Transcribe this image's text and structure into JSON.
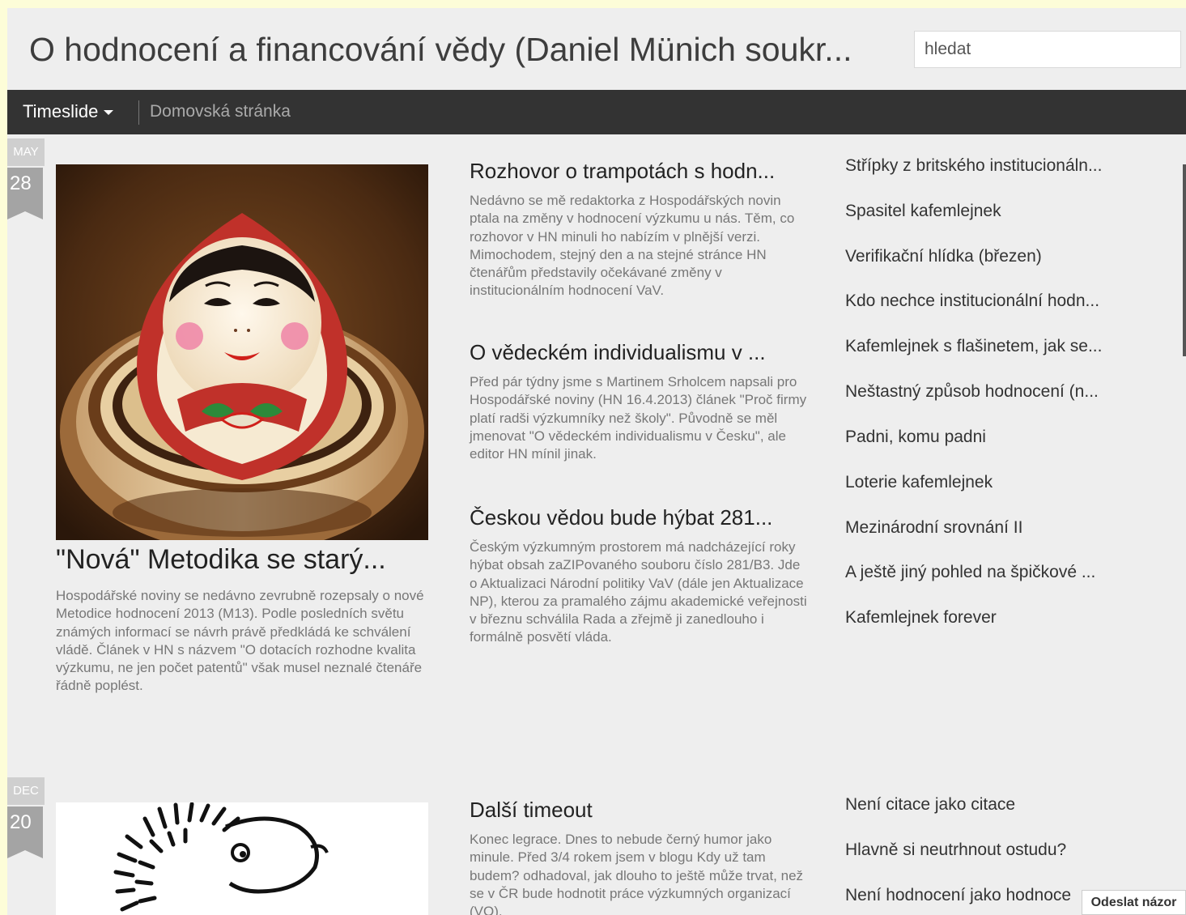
{
  "header": {
    "title": "O hodnocení a financování vědy (Daniel Münich soukr...",
    "search_placeholder": "hledat"
  },
  "nav": {
    "view_label": "Timeslide",
    "home_label": "Domovská stránka"
  },
  "group1": {
    "month": "MAY",
    "day": "28",
    "feature": {
      "image_icon": "matryoshka-doll-image",
      "title": "\"Nová\" Metodika se starý...",
      "snippet": "Hospodářské noviny se nedávno zevrubně rozepsaly o nové Metodice hodnocení 2013 (M13). Podle posledních světu známých informací se návrh právě předkládá ke schválení vládě. Článek v HN s názvem \"O dotacích rozhodne kvalita výzkumu, ne jen počet patentů\" však musel neznalé čtenáře řádně poplést."
    },
    "posts": [
      {
        "title": "Rozhovor o trampotách s hodn...",
        "snippet": "Nedávno se mě redaktorka z Hospodářských novin ptala na změny v hodnocení výzkumu u nás. Těm, co rozhovor v HN minuli ho nabízím v plnější verzi. Mimochodem, stejný den a na stejné stránce HN čtenářům představily očekávané změny v institucionálním hodnocení VaV."
      },
      {
        "title": "O vědeckém individualismu v ...",
        "snippet": "Před pár týdny jsme s Martinem Srholcem napsali pro Hospodářské noviny (HN 16.4.2013) článek \"Proč firmy platí radši výzkumníky než školy\". Původně se měl jmenovat \"O vědeckém individualismu v Česku\", ale editor HN mínil jinak."
      },
      {
        "title": "Českou vědou bude hýbat 281...",
        "snippet": "Českým výzkumným prostorem má nadcházející roky hýbat obsah zaZIPovaného souboru číslo 281/B3. Jde o Aktualizaci Národní politiky VaV (dále jen Aktualizace NP), kterou  za pramalého zájmu akademické veřejnosti v březnu schválila Rada a zřejmě ji zanedlouho i formálně posvětí vláda."
      }
    ],
    "links": [
      "Střípky z britského institucionáln...",
      "Spasitel kafemlejnek",
      "Verifikační hlídka (březen)",
      "Kdo nechce institucionální hodn...",
      "Kafemlejnek s flašinetem, jak se...",
      "Neštastný způsob hodnocení (n...",
      "Padni, komu padni",
      "Loterie kafemlejnek",
      "Mezinárodní srovnání II",
      "A ještě jiný pohled na špičkové ...",
      "Kafemlejnek forever"
    ]
  },
  "group2": {
    "month": "DEC",
    "day": "20",
    "feature": {
      "image_icon": "hedgehog-drawing-image"
    },
    "posts": [
      {
        "title": "Další timeout",
        "snippet": "Konec legrace. Dnes to nebude černý humor jako minule. Před 3/4 rokem jsem v blogu Kdy už tam budem? odhadoval, jak dlouho to ještě může trvat, než se v ČR bude hodnotit práce výzkumných organizací (VO)."
      }
    ],
    "links": [
      "Není citace jako citace",
      "Hlavně si neutrhnout ostudu?",
      "Není hodnocení jako hodnoce"
    ]
  },
  "feedback": {
    "label": "Odeslat názor"
  }
}
